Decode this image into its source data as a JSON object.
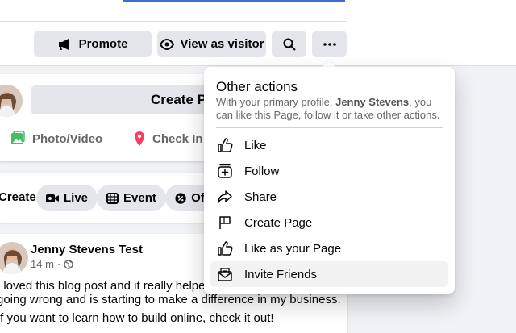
{
  "header": {
    "buttons": {
      "promote": "Promote",
      "view_as_visitor": "View as visitor"
    }
  },
  "composer": {
    "create_post": "Create Post",
    "photo_video": "Photo/Video",
    "check_in": "Check In"
  },
  "create_bar": {
    "label": "Create",
    "live": "Live",
    "event": "Event",
    "offer": "Offer"
  },
  "post": {
    "author": "Jenny Stevens Test",
    "time": "14 m",
    "line1": "I loved this blog post and it really helped me figure out what was",
    "line2": "going wrong and is starting to make a difference in my business.",
    "line3": "If you want to learn how to build online, check it out!"
  },
  "menu": {
    "title": "Other actions",
    "desc_prefix": "With your primary profile, ",
    "desc_name": "Jenny Stevens",
    "desc_suffix": ", you can like this Page, follow it or take other actions.",
    "items": [
      {
        "label": "Like",
        "icon": "thumbs-up-icon"
      },
      {
        "label": "Follow",
        "icon": "follow-icon"
      },
      {
        "label": "Share",
        "icon": "share-icon"
      },
      {
        "label": "Create Page",
        "icon": "flag-icon"
      },
      {
        "label": "Like as your Page",
        "icon": "thumbs-up-icon"
      },
      {
        "label": "Invite Friends",
        "icon": "envelope-icon"
      }
    ]
  },
  "colors": {
    "accent_blue": "#3b6ed3",
    "photo_green": "#45bd62",
    "checkin_red": "#f3425f"
  }
}
